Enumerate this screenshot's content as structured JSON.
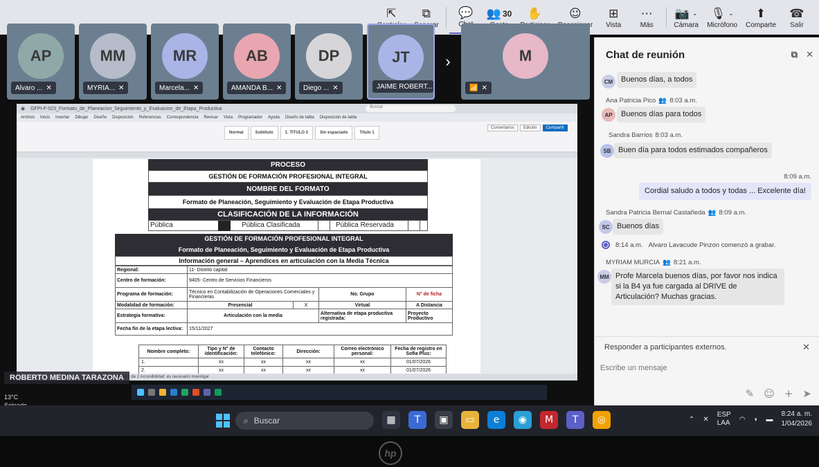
{
  "toolbar": {
    "items": [
      {
        "label": "Controlar",
        "icon": "control-icon"
      },
      {
        "label": "Separar",
        "icon": "popout-icon"
      },
      {
        "label": "Chat",
        "icon": "chat-icon"
      },
      {
        "label": "Gente",
        "icon": "people-icon",
        "count": "30"
      },
      {
        "label": "Participar",
        "icon": "raise-hand-icon"
      },
      {
        "label": "Reaccionar",
        "icon": "react-icon"
      },
      {
        "label": "Vista",
        "icon": "view-icon"
      },
      {
        "label": "Más",
        "icon": "more-icon"
      },
      {
        "label": "Cámara",
        "icon": "camera-off-icon"
      },
      {
        "label": "Micrófono",
        "icon": "mic-off-icon"
      },
      {
        "label": "Comparte",
        "icon": "share-icon"
      },
      {
        "label": "Salir",
        "icon": "leave-icon"
      }
    ]
  },
  "participants": [
    {
      "initials": "AP",
      "name": "Alvaro ...",
      "color": "#8fa9a9"
    },
    {
      "initials": "MM",
      "name": "MYRIA...",
      "color": "#b6bcc9"
    },
    {
      "initials": "MR",
      "name": "Marcela...",
      "color": "#aab4e6"
    },
    {
      "initials": "AB",
      "name": "AMANDA B...",
      "color": "#e9a6b0"
    },
    {
      "initials": "DP",
      "name": "Diego ...",
      "color": "#d6d6d8"
    },
    {
      "initials": "JT",
      "name": "JAIME ROBERT...",
      "color": "#a9b5e6"
    },
    {
      "initials": "M",
      "name": "",
      "color": "#e6b8c8"
    }
  ],
  "word": {
    "title": "GFPI-F-023_Formato_de_Planeacion_Seguimiento_y_Evaluacion_de_Etapa_Productiva",
    "search": "Buscar",
    "menu": [
      "Archivo",
      "Inicio",
      "Insertar",
      "Dibujar",
      "Diseño",
      "Disposición",
      "Referencias",
      "Correspondencia",
      "Revisar",
      "Vista",
      "Programador",
      "Ayuda",
      "Diseño de tabla",
      "Disposición de tabla"
    ],
    "styles": [
      "Normal",
      "Subtítulo",
      "1. TITULO 2",
      "Sin espaciado",
      "Título 1"
    ],
    "ribbon_right": [
      "Comentarios",
      "Edición",
      "Compartir"
    ],
    "status": "Página 1 de 2   Accesibilidad: es necesario investigar"
  },
  "doc": {
    "proceso": "PROCESO",
    "gestion": "GESTIÓN DE FORMACIÓN PROFESIONAL INTEGRAL",
    "nombre_formato": "NOMBRE DEL FORMATO",
    "formato": "Formato de Planeación, Seguimiento y Evaluación de Etapa Productiva",
    "clasificacion": "CLASIFICACIÓN DE LA INFORMACIÓN",
    "publica": "Pública",
    "publica_clasificada": "Pública Clasificada",
    "publica_reservada": "Pública Reservada",
    "gestion2": "GESTIÓN DE FORMACIÓN PROFESIONAL INTEGRAL",
    "formato2": "Formato de Planeación, Seguimiento y Evaluación de Etapa Productiva",
    "info_general": "Información general – Aprendices en articulación con la Media Técnica",
    "regional_label": "Regional:",
    "regional_value": "11- Distrito capital",
    "centro_label": "Centro de formación:",
    "centro_value": "9405- Centro de Servicios Financieros",
    "programa_label": "Programa de formación:",
    "programa_value": "Técnico en Contabilización de Operaciones Comerciales y Financieras",
    "grupo_label": "No. Grupo",
    "ficha_label": "N° de ficha",
    "modalidad_label": "Modalidad de formación:",
    "presencial": "Presencial",
    "x_mark": "X",
    "virtual": "Virtual",
    "distancia": "A Distancia",
    "estrategia_label": "Estrategia formativa:",
    "estrategia_value": "Articulación con la media",
    "alternativa_label": "Alternativa de etapa productiva registrada:",
    "alternativa_value": "Proyecto Productivo",
    "fecha_label": "Fecha fin de la etapa lectiva:",
    "fecha_value": "15/11/2027",
    "list_headers": [
      "Nombre completo:",
      "Tipo y N° de identificación:",
      "Contacto telefónico:",
      "Dirección:",
      "Correo electrónico personal:",
      "Fecha de registro en Sofia Plus:"
    ],
    "rows": [
      {
        "n": "1.",
        "id": "xx",
        "tel": "xx",
        "dir": "xx",
        "mail": "xx",
        "date": "01/07/2026"
      },
      {
        "n": "2.",
        "id": "xx",
        "tel": "xx",
        "dir": "xx",
        "mail": "xx",
        "date": "01/07/2026"
      }
    ]
  },
  "presenter": "ROBERTO MEDINA TARAZONA",
  "weather": {
    "temp": "13°C",
    "desc": "Soleado"
  },
  "taskbar": {
    "search": "Buscar",
    "lang": "ESP",
    "lang2": "LAA",
    "time": "8:24 a. m.",
    "date": "1/04/2026"
  },
  "chat": {
    "title": "Chat de reunión",
    "messages": [
      {
        "initials": "CM",
        "avatar_color": "#c9cde8",
        "meta": "",
        "text": "Buenos días, a todos"
      },
      {
        "initials": "AP",
        "avatar_color": "#e8b9b9",
        "meta": "Ana Patricia Pico",
        "time": "8:03 a.m.",
        "text": "Buenos días para todos"
      },
      {
        "initials": "SB",
        "avatar_color": "#b7c2ea",
        "meta": "Sandra Barrios",
        "time": "8:03 a.m.",
        "text": "Buen día para todos estimados compañeros"
      },
      {
        "mine": true,
        "time": "8:09 a.m.",
        "text": "Cordial saludo a todos y todas ... Excelente día!"
      },
      {
        "initials": "SC",
        "avatar_color": "#c3c8e8",
        "meta": "Sandra Patricia Bernal Castañeda",
        "time": "8:09 a.m.",
        "text": "Buenos días"
      },
      {
        "system": true,
        "time": "8:14 a.m.",
        "text": "Alvaro Lavacude Pinzon comenzó a grabar."
      },
      {
        "initials": "MM",
        "avatar_color": "#c9cde8",
        "meta": "MYRIAM MURCIA",
        "time": "8:21 a.m.",
        "text": "Profe Marcela buenos días, por favor nos indica si la B4 ya fue cargada al DRIVE de Articulación? Muchas gracias."
      }
    ],
    "reply_label": "Responder a participantes externos.",
    "placeholder": "Escribe un mensaje"
  }
}
